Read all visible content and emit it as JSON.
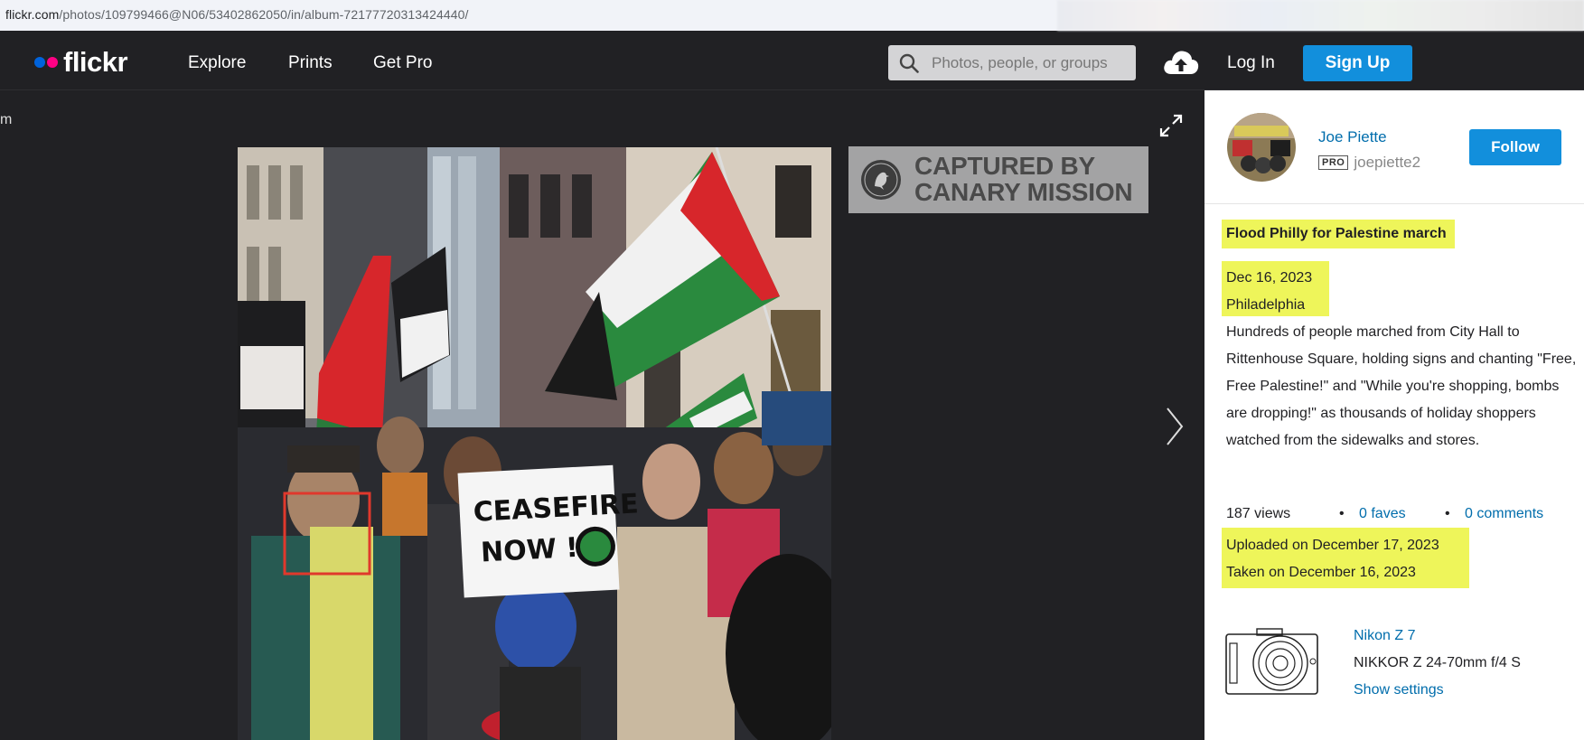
{
  "browser": {
    "url_domain": "flickr.com",
    "url_path": "/photos/109799466@N06/53402862050/in/album-72177720313424440/"
  },
  "nav": {
    "logo_text": "flickr",
    "links": [
      "Explore",
      "Prints",
      "Get Pro"
    ],
    "search_placeholder": "Photos, people, or groups",
    "login": "Log In",
    "signup": "Sign Up"
  },
  "viewer": {
    "back_fragment": "m",
    "watermark_line1": "CAPTURED BY",
    "watermark_line2": "CANARY MISSION",
    "sign_line1": "CEASEFIRE",
    "sign_line2": "NOW !"
  },
  "author": {
    "name": "Joe Piette",
    "badge": "PRO",
    "username": "joepiette2",
    "follow_label": "Follow"
  },
  "photo_info": {
    "title": "Flood Philly for Palestine march",
    "date": "Dec 16, 2023",
    "place": "Philadelphia",
    "description": "Hundreds of people marched from City Hall to Rittenhouse Square, holding signs and chanting \"Free, Free Palestine!\" and \"While you're shopping, bombs are dropping!\" as thousands of holiday shoppers watched from the sidewalks and stores.",
    "views": "187 views",
    "faves": "0 faves",
    "comments": "0 comments",
    "uploaded": "Uploaded on December 17, 2023",
    "taken": "Taken on December 16, 2023"
  },
  "exif": {
    "camera": "Nikon Z 7",
    "lens": "NIKKOR Z 24-70mm f/4 S",
    "show_settings": "Show settings"
  },
  "icons": [
    "search-icon",
    "upload-cloud-icon",
    "expand-icon",
    "next-arrow-icon",
    "camera-icon",
    "canary-seal-icon"
  ],
  "colors": {
    "accent": "#128fdc",
    "link": "#006dac",
    "highlight": "#eef55a",
    "navbar": "#212124",
    "face_box": "#e0382c"
  }
}
